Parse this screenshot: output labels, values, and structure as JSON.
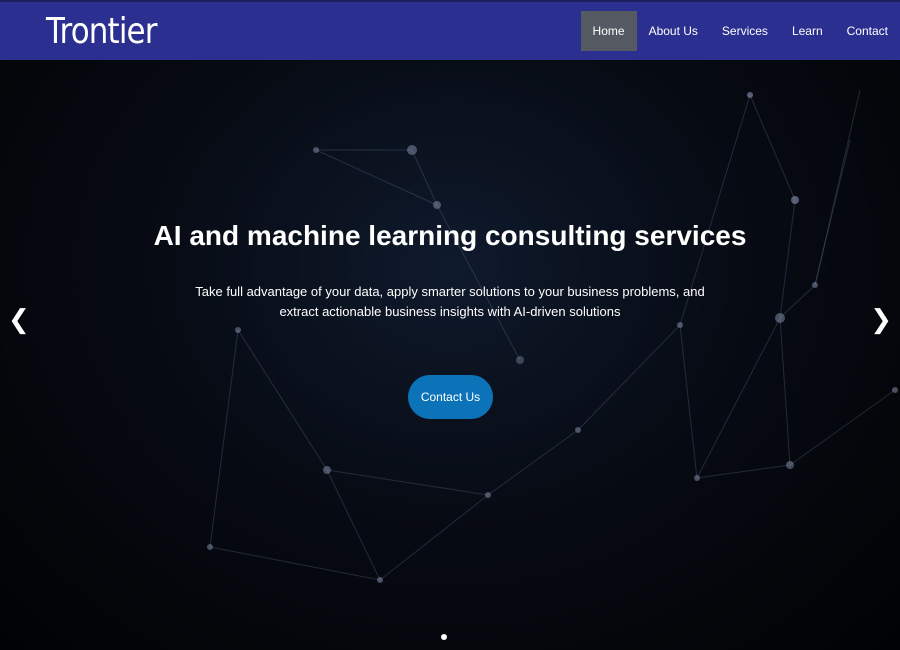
{
  "brand": {
    "name": "Trontier"
  },
  "nav": {
    "items": [
      {
        "label": "Home",
        "active": true
      },
      {
        "label": "About Us"
      },
      {
        "label": "Services"
      },
      {
        "label": "Learn"
      },
      {
        "label": "Contact"
      }
    ]
  },
  "hero": {
    "title": "AI and machine learning consulting services",
    "subtitle": "Take full advantage of your data, apply smarter solutions to your business problems, and extract actionable business insights with AI-driven solutions",
    "cta_label": "Contact Us",
    "prev_icon": "chevron-left-icon",
    "next_icon": "chevron-right-icon",
    "slide_count": 1,
    "active_slide": 1
  },
  "colors": {
    "navbar": "#2b2f8f",
    "nav_active": "#555a62",
    "cta": "#0d73b8",
    "background": "#000000"
  }
}
